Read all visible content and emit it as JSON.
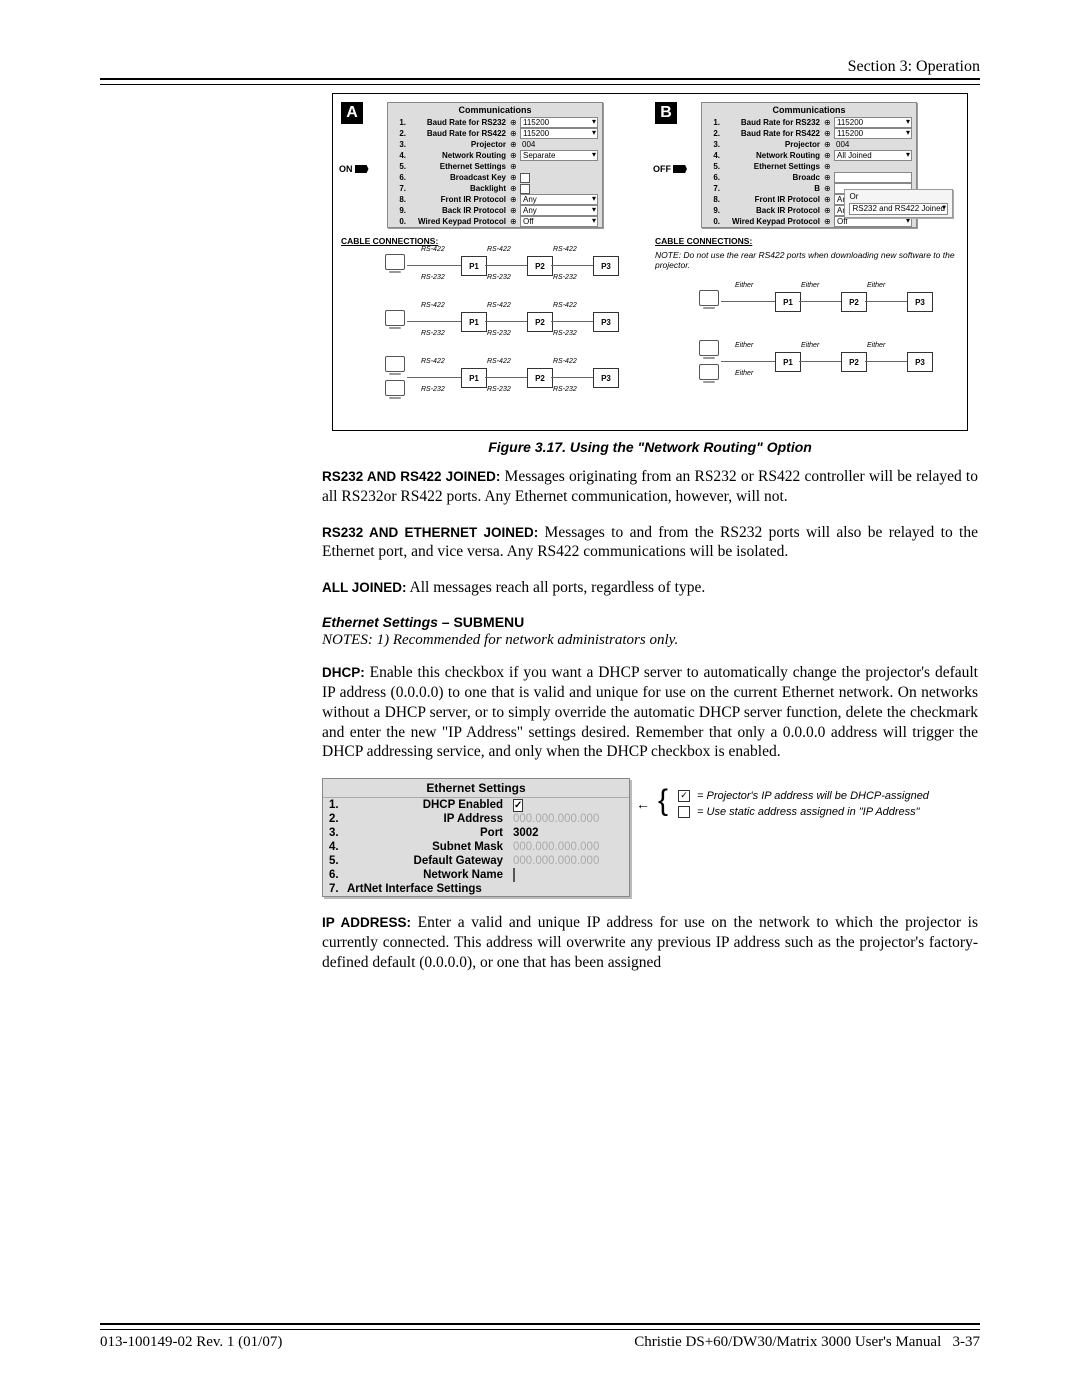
{
  "header": {
    "section": "Section 3: Operation"
  },
  "figure": {
    "panelA": {
      "toggle": "ON",
      "menu_title": "Communications",
      "rows": [
        {
          "n": "1.",
          "label": "Baud Rate for RS232",
          "value": "115200",
          "dd": true
        },
        {
          "n": "2.",
          "label": "Baud Rate for RS422",
          "value": "115200",
          "dd": true
        },
        {
          "n": "3.",
          "label": "Projector",
          "value": "004",
          "dd": false,
          "nobox": true
        },
        {
          "n": "4.",
          "label": "Network Routing",
          "value": "Separate",
          "dd": true
        },
        {
          "n": "5.",
          "label": "Ethernet Settings",
          "value": "",
          "dd": false,
          "nobox": true
        },
        {
          "n": "6.",
          "label": "Broadcast Key",
          "value": "",
          "chk": true
        },
        {
          "n": "7.",
          "label": "Backlight",
          "value": "",
          "chk": true
        },
        {
          "n": "8.",
          "label": "Front IR Protocol",
          "value": "Any",
          "dd": true
        },
        {
          "n": "9.",
          "label": "Back IR Protocol",
          "value": "Any",
          "dd": true
        },
        {
          "n": "0.",
          "label": "Wired Keypad Protocol",
          "value": "Off",
          "dd": true
        }
      ],
      "cable_label": "CABLE CONNECTIONS:"
    },
    "panelB": {
      "toggle": "OFF",
      "menu_title": "Communications",
      "rows": [
        {
          "n": "1.",
          "label": "Baud Rate for RS232",
          "value": "115200",
          "dd": true
        },
        {
          "n": "2.",
          "label": "Baud Rate for RS422",
          "value": "115200",
          "dd": true
        },
        {
          "n": "3.",
          "label": "Projector",
          "value": "004",
          "dd": false,
          "nobox": true
        },
        {
          "n": "4.",
          "label": "Network Routing",
          "value": "All Joined",
          "dd": true
        },
        {
          "n": "5.",
          "label": "Ethernet Settings",
          "value": "",
          "dd": false,
          "nobox": true
        },
        {
          "n": "6.",
          "label": "Broadc",
          "value": "",
          "partial": true
        },
        {
          "n": "7.",
          "label": "B",
          "value": "",
          "partial": true
        },
        {
          "n": "8.",
          "label": "Front IR Protocol",
          "value": "Any",
          "dd": true
        },
        {
          "n": "9.",
          "label": "Back IR Protocol",
          "value": "Any",
          "dd": true
        },
        {
          "n": "0.",
          "label": "Wired Keypad Protocol",
          "value": "Off",
          "dd": true
        }
      ],
      "or_label": "Or",
      "or_option": "RS232 and RS422 Joined",
      "cable_label": "CABLE CONNECTIONS:",
      "note": "NOTE: Do not use the rear  RS422 ports when down­loading new software to the projector."
    },
    "diagram_labels": {
      "rs422": "RS-422",
      "rs232": "RS-232",
      "either": "Either",
      "p1": "P1",
      "p2": "P2",
      "p3": "P3"
    },
    "caption": "Figure 3.17. Using the \"Network Routing\" Option"
  },
  "paragraphs": {
    "p1_lead": "RS232 AND RS422 JOINED:",
    "p1_body": " Messages originating from an RS232 or RS422 controller will be relayed to all RS232or RS422 ports. Any Ethernet communication, however, will not.",
    "p2_lead": "RS232 AND ETHERNET JOINED:",
    "p2_body": " Messages to and from the RS232 ports will also be relayed to the Ethernet port, and vice versa. Any RS422 communications will be isolated.",
    "p3_lead": "ALL JOINED:",
    "p3_body": " All messages reach all ports, regardless of type.",
    "sub_hdr_ital": "Ethernet Settings",
    "sub_hdr_rest": " – SUBMENU",
    "notes": "NOTES: 1) Recommended for network administrators only.",
    "dhcp_lead": "DHCP:",
    "dhcp_body": " Enable this checkbox if you want a DHCP server to automatically change the projector's default IP address (0.0.0.0) to one that is valid and unique for use on the current Ethernet network. On networks without a DHCP server, or to simply override the automatic DHCP server function, delete the checkmark and enter the new \"IP Address\" settings desired. Remember that only a 0.0.0.0 address will trigger the DHCP addressing service, and only when the DHCP checkbox is enabled.",
    "ip_lead": "IP ADDRESS:",
    "ip_body": " Enter a valid and unique IP address for use on the network to which the projector is currently connected. This address will overwrite any previous IP address such as the projector's factory-defined default (0.0.0.0), or one that has been assigned"
  },
  "ethernet_menu": {
    "title": "Ethernet Settings",
    "rows": [
      {
        "n": "1.",
        "label": "DHCP Enabled",
        "type": "chk",
        "checked": true
      },
      {
        "n": "2.",
        "label": "IP Address",
        "type": "dim",
        "value": "000.000.000.000"
      },
      {
        "n": "3.",
        "label": "Port",
        "type": "val",
        "value": "3002"
      },
      {
        "n": "4.",
        "label": "Subnet Mask",
        "type": "dim",
        "value": "000.000.000.000"
      },
      {
        "n": "5.",
        "label": "Default Gateway",
        "type": "dim",
        "value": "000.000.000.000"
      },
      {
        "n": "6.",
        "label": "Network Name",
        "type": "txt",
        "value": ""
      },
      {
        "n": "7.",
        "label": "ArtNet Interface Settings",
        "type": "full"
      }
    ],
    "legend_checked": " = Projector's IP address will be DHCP-assigned",
    "legend_unchecked": " = Use static address assigned in \"IP Address\""
  },
  "footer": {
    "left": "013-100149-02 Rev. 1 (01/07)",
    "right_text": "Christie DS+60/DW30/Matrix 3000 User's Manual",
    "right_page": "3-37"
  }
}
